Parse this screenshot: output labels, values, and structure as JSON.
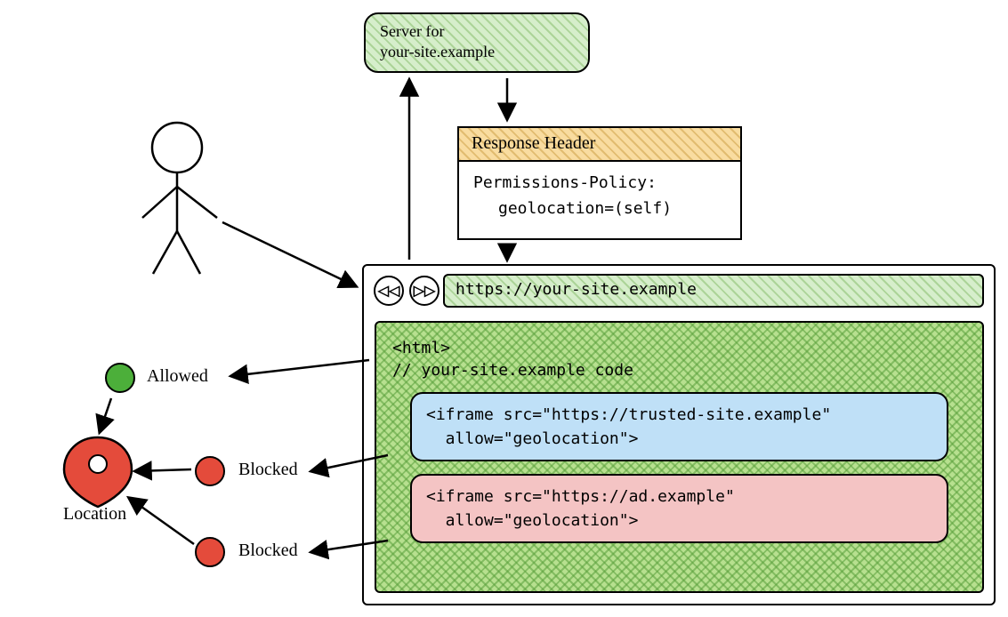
{
  "server": {
    "line1": "Server for",
    "line2": "your-site.example"
  },
  "response_header": {
    "title": "Response Header",
    "line1": "Permissions-Policy:",
    "line2": "geolocation=(self)"
  },
  "browser": {
    "url": "https://your-site.example",
    "back_label": "◁◁",
    "fwd_label": "▷▷"
  },
  "page": {
    "html_open": "<html>",
    "comment": "// your-site.example code",
    "iframe_trusted_l1": "<iframe src=\"https://trusted-site.example\"",
    "iframe_trusted_l2": "  allow=\"geolocation\">",
    "iframe_ad_l1": "<iframe src=\"https://ad.example\"",
    "iframe_ad_l2": "  allow=\"geolocation\">"
  },
  "labels": {
    "allowed": "Allowed",
    "blocked1": "Blocked",
    "blocked2": "Blocked",
    "location": "Location"
  }
}
